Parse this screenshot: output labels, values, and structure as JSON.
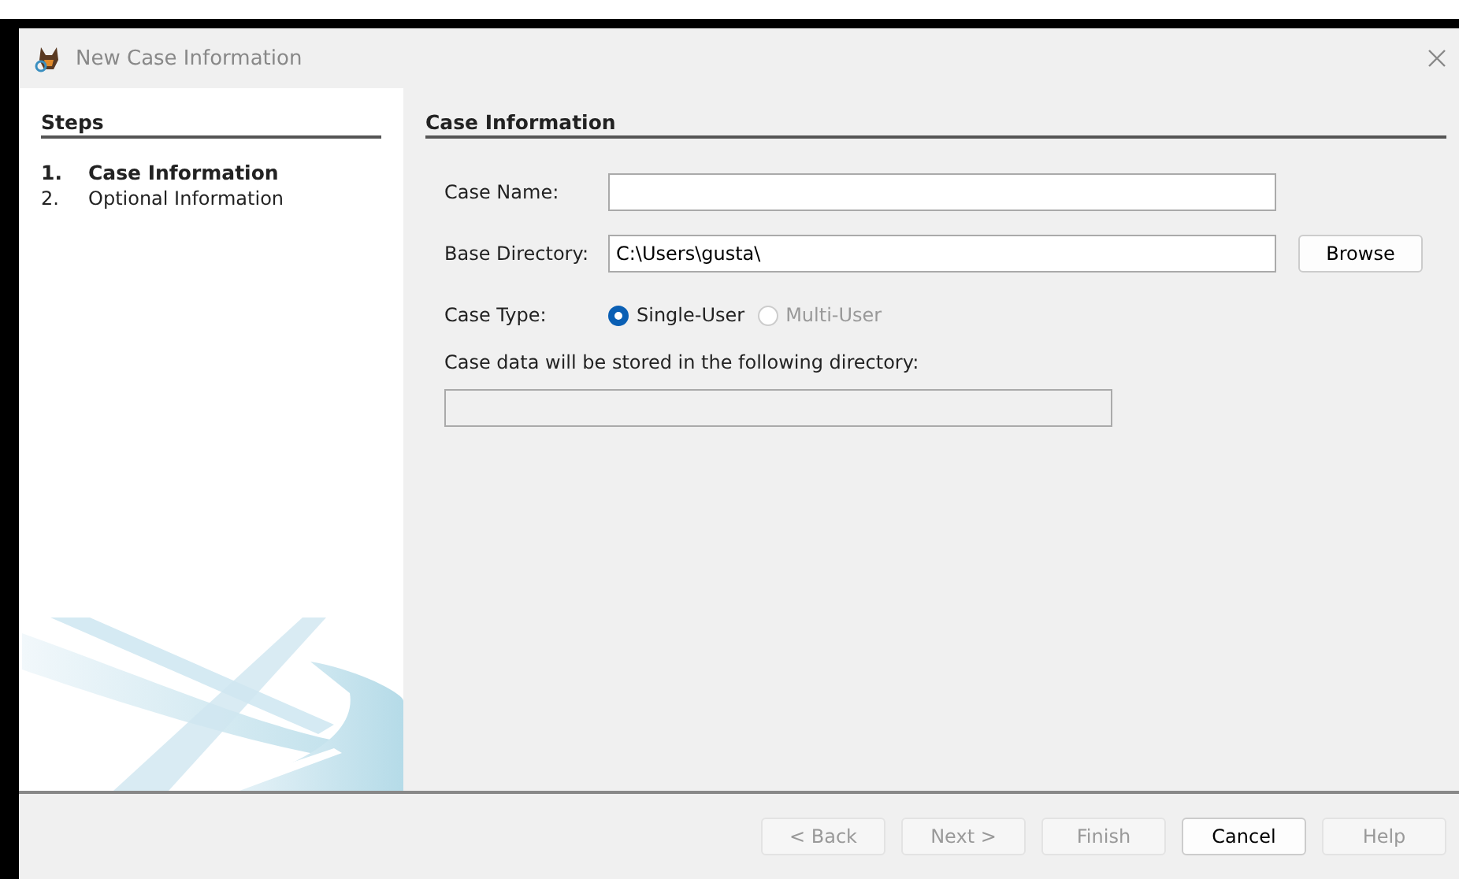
{
  "window": {
    "title": "New Case Information"
  },
  "steps": {
    "heading": "Steps",
    "items": [
      {
        "number": "1.",
        "label": "Case Information",
        "selected": true
      },
      {
        "number": "2.",
        "label": "Optional Information",
        "selected": false
      }
    ]
  },
  "panel": {
    "heading": "Case Information",
    "case_name": {
      "label": "Case Name:"
    },
    "base_directory": {
      "label": "Base Directory:",
      "value": "C:\\Users\\gusta\\",
      "button": "Browse"
    },
    "case_type": {
      "label": "Case Type:",
      "options": [
        {
          "label": "Single-User",
          "selected": true,
          "disabled": false
        },
        {
          "label": "Multi-User",
          "selected": false,
          "disabled": true
        }
      ]
    },
    "storage": {
      "label": "Case data will be stored in the following directory:"
    }
  },
  "buttons": [
    {
      "label": "< Back",
      "disabled": true
    },
    {
      "label": "Next >",
      "disabled": true
    },
    {
      "label": "Finish",
      "disabled": true
    },
    {
      "label": "Cancel",
      "disabled": false
    },
    {
      "label": "Help",
      "disabled": true
    }
  ]
}
